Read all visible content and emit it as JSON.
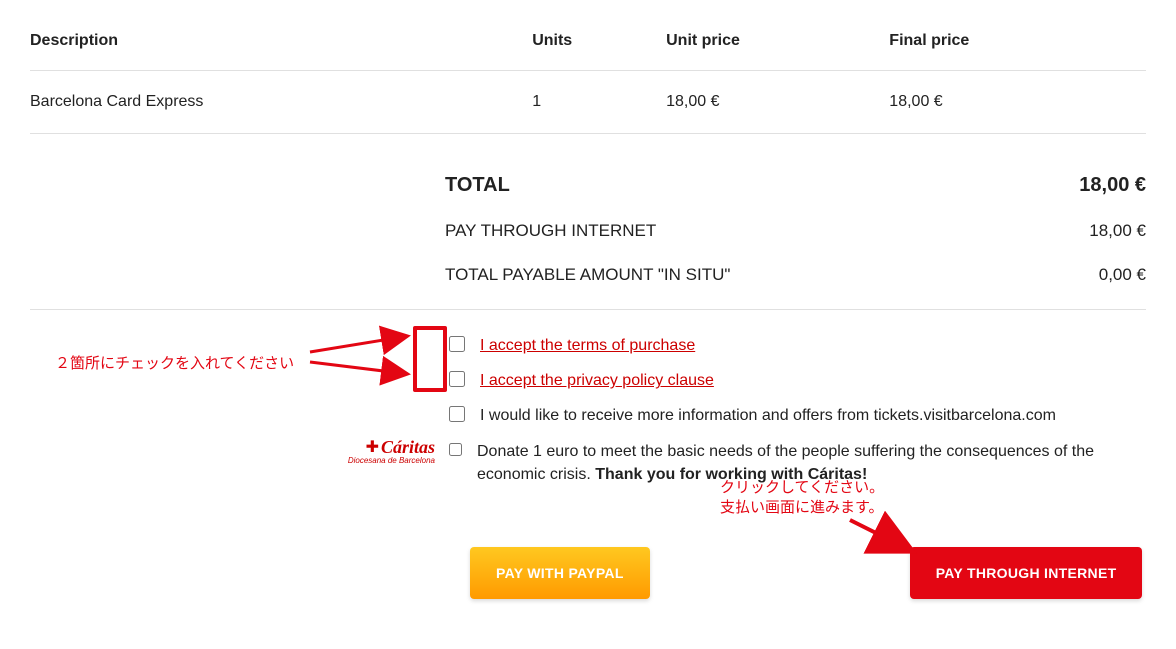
{
  "table": {
    "headers": {
      "description": "Description",
      "units": "Units",
      "unit_price": "Unit price",
      "final_price": "Final price"
    },
    "rows": [
      {
        "description": "Barcelona Card Express",
        "units": "1",
        "unit_price": "18,00 €",
        "final_price": "18,00 €"
      }
    ]
  },
  "totals": {
    "total_label": "TOTAL",
    "total_value": "18,00 €",
    "internet_label": "PAY THROUGH INTERNET",
    "internet_value": "18,00 €",
    "insitu_label": "TOTAL PAYABLE AMOUNT \"IN SITU\"",
    "insitu_value": "0,00 €"
  },
  "checks": {
    "terms": "I accept the terms of purchase",
    "privacy": "I accept the privacy policy clause",
    "marketing": "I would like to receive more information and offers from tickets.visitbarcelona.com",
    "donate_pre": "Donate 1 euro to meet the basic needs of the people suffering the consequences of the economic crisis. ",
    "donate_bold": "Thank you for working with Cáritas!"
  },
  "caritas": {
    "name": "Cáritas",
    "sub": "Diocesana de Barcelona"
  },
  "buttons": {
    "paypal": "PAY WITH PAYPAL",
    "internet": "PAY THROUGH INTERNET"
  },
  "annotations": {
    "check_note": "２箇所にチェックを入れてください",
    "click_note_1": "クリックしてください。",
    "click_note_2": "支払い画面に進みます。"
  }
}
